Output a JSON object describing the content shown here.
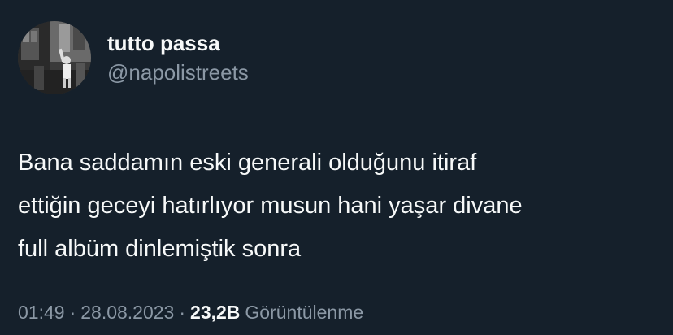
{
  "author": {
    "display_name": "tutto passa",
    "handle": "@napolistreets",
    "avatar_icon": "avatar-photo"
  },
  "tweet": {
    "text": "Bana saddamın eski generali olduğunu itiraf\nettiğin geceyi hatırlıyor musun hani yaşar divane\nfull albüm dinlemiştik sonra"
  },
  "meta": {
    "time": "01:49",
    "separator": "·",
    "date": "28.08.2023",
    "views_count": "23,2B",
    "views_label": "Görüntülenme"
  },
  "colors": {
    "background": "#15202b",
    "primary_text": "#f7f9f9",
    "secondary_text": "#8b98a5"
  }
}
